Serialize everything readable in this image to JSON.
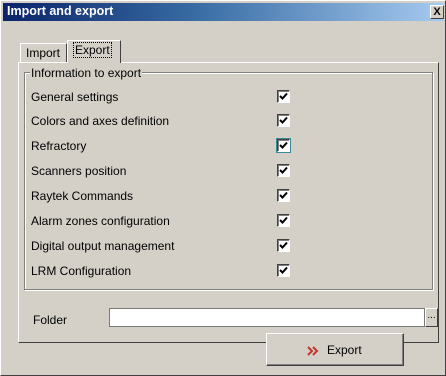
{
  "window": {
    "title": "Import and export",
    "close_glyph": "X"
  },
  "tabs": [
    {
      "label": "Import",
      "active": false
    },
    {
      "label": "Export",
      "active": true
    }
  ],
  "group": {
    "title": "Information to export",
    "items": [
      {
        "label": "General settings",
        "checked": true
      },
      {
        "label": "Colors and axes definition",
        "checked": true
      },
      {
        "label": "Refractory",
        "checked": true
      },
      {
        "label": "Scanners position",
        "checked": true
      },
      {
        "label": "Raytek Commands",
        "checked": true
      },
      {
        "label": "Alarm zones configuration",
        "checked": true
      },
      {
        "label": "Digital output management",
        "checked": true
      },
      {
        "label": "LRM Configuration",
        "checked": true
      }
    ]
  },
  "folder": {
    "label": "Folder",
    "value": "",
    "browse_label": "..."
  },
  "export_button": {
    "label": "Export",
    "icon": "double-chevron-right-icon",
    "icon_color": "#c0392b"
  },
  "colors": {
    "title_start": "#0a246a",
    "title_end": "#a6caf0",
    "face": "#d4d0c8"
  }
}
